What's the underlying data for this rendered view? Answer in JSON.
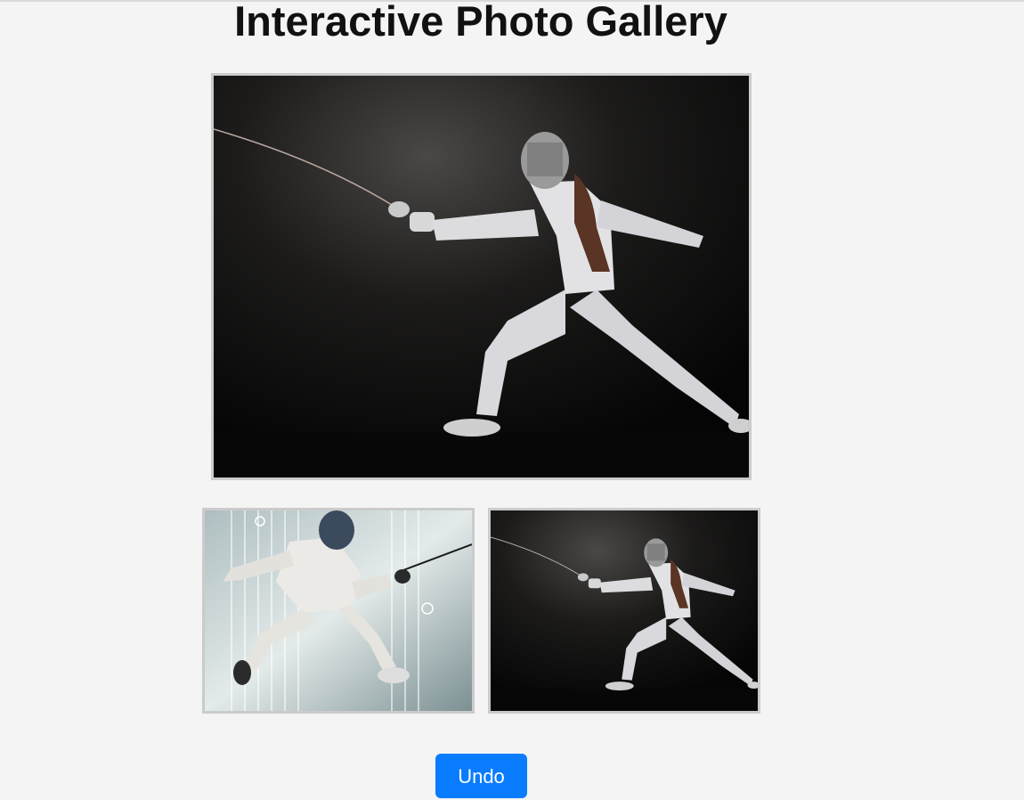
{
  "page": {
    "title": "Interactive Photo Gallery"
  },
  "gallery": {
    "main_image": "fencer-lunge-dark",
    "thumbnails": [
      {
        "image": "fencer-leap-light"
      },
      {
        "image": "fencer-lunge-dark"
      }
    ]
  },
  "controls": {
    "undo_label": "Undo",
    "undo_color": "#0a7cff"
  }
}
